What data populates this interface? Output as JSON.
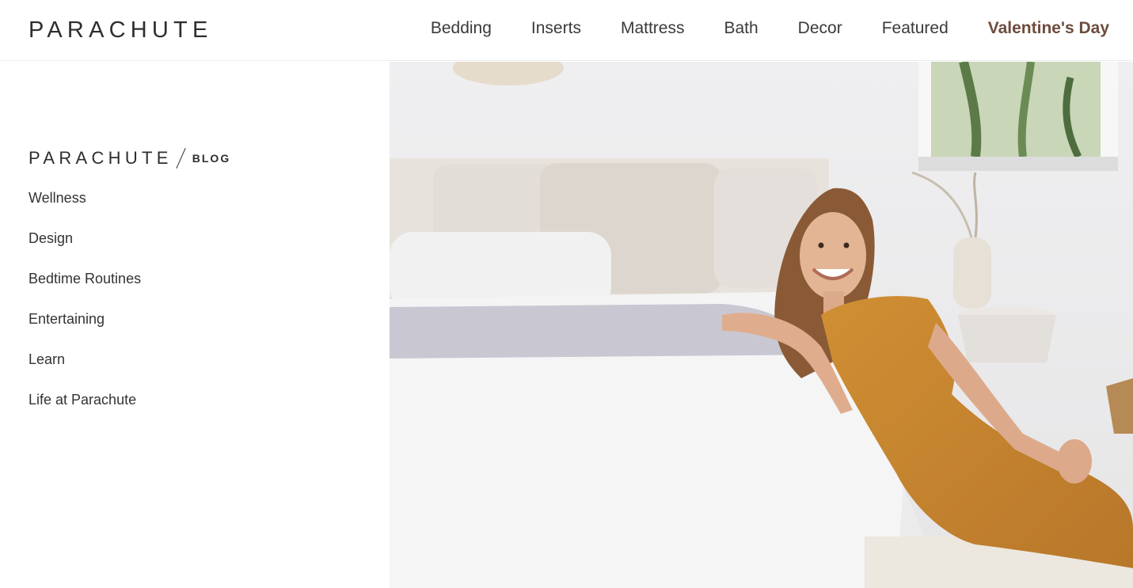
{
  "header": {
    "logo": "PARACHUTE",
    "nav": [
      {
        "label": "Bedding"
      },
      {
        "label": "Inserts"
      },
      {
        "label": "Mattress"
      },
      {
        "label": "Bath"
      },
      {
        "label": "Decor"
      },
      {
        "label": "Featured"
      },
      {
        "label": "Valentine's Day"
      }
    ]
  },
  "blog": {
    "logo": "PARACHUTE",
    "tag": "BLOG",
    "categories": [
      {
        "label": "Wellness"
      },
      {
        "label": "Design"
      },
      {
        "label": "Bedtime Routines"
      },
      {
        "label": "Entertaining"
      },
      {
        "label": "Learn"
      },
      {
        "label": "Life at Parachute"
      }
    ]
  },
  "hero": {
    "image": "bedroom-photo-woman-leaning-on-bed",
    "colors": {
      "wall": "#ecebec",
      "dress": "#c5842f",
      "hair": "#8a5a36",
      "throw": "#c9c8d2"
    }
  },
  "colors": {
    "accent": "#6e4c3e",
    "text": "#333333",
    "divider": "#ececec"
  }
}
